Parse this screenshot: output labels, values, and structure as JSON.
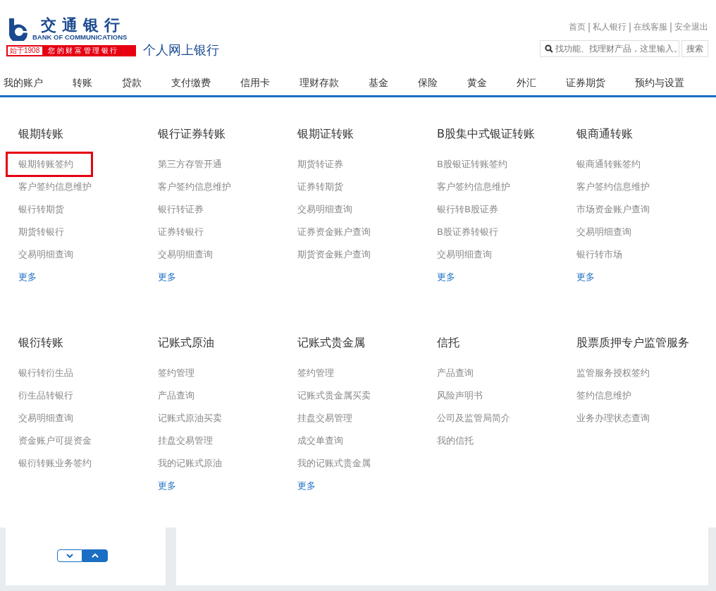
{
  "logo": {
    "name_cn": "交通银行",
    "name_en": "BANK OF COMMUNICATIONS",
    "since": "始于1908",
    "slogan": "您的财富管理银行"
  },
  "site_title": "个人网上银行",
  "top_links": [
    "首页",
    "私人银行",
    "在线客服",
    "安全退出"
  ],
  "search": {
    "placeholder": "找功能、找理财产品，这里输入。",
    "button": "搜索"
  },
  "nav": [
    "我的账户",
    "转账",
    "贷款",
    "支付缴费",
    "信用卡",
    "理财存款",
    "基金",
    "保险",
    "黄金",
    "外汇",
    "证券期货",
    "预约与设置"
  ],
  "menu_sections": [
    {
      "groups": [
        {
          "title": "银期转账",
          "items": [
            {
              "label": "银期转账签约",
              "selected": true
            },
            {
              "label": "客户签约信息维护",
              "selected": false
            },
            {
              "label": "银行转期货",
              "selected": false
            },
            {
              "label": "期货转银行",
              "selected": false
            },
            {
              "label": "交易明细查询",
              "selected": false
            }
          ],
          "more": "更多"
        },
        {
          "title": "银行证券转账",
          "items": [
            {
              "label": "第三方存管开通",
              "selected": false
            },
            {
              "label": "客户签约信息维护",
              "selected": false
            },
            {
              "label": "银行转证券",
              "selected": false
            },
            {
              "label": "证券转银行",
              "selected": false
            },
            {
              "label": "交易明细查询",
              "selected": false
            }
          ],
          "more": "更多"
        },
        {
          "title": "银期证转账",
          "items": [
            {
              "label": "期货转证券",
              "selected": false
            },
            {
              "label": "证券转期货",
              "selected": false
            },
            {
              "label": "交易明细查询",
              "selected": false
            },
            {
              "label": "证券资金账户查询",
              "selected": false
            },
            {
              "label": "期货资金账户查询",
              "selected": false
            }
          ]
        },
        {
          "title": "B股集中式银证转账",
          "items": [
            {
              "label": "B股银证转账签约",
              "selected": false
            },
            {
              "label": "客户签约信息维护",
              "selected": false
            },
            {
              "label": "银行转B股证券",
              "selected": false
            },
            {
              "label": "B股证券转银行",
              "selected": false
            },
            {
              "label": "交易明细查询",
              "selected": false
            }
          ],
          "more": "更多"
        },
        {
          "title": "银商通转账",
          "items": [
            {
              "label": "银商通转账签约",
              "selected": false
            },
            {
              "label": "客户签约信息维护",
              "selected": false
            },
            {
              "label": "市场资金账户查询",
              "selected": false
            },
            {
              "label": "交易明细查询",
              "selected": false
            },
            {
              "label": "银行转市场",
              "selected": false
            }
          ],
          "more": "更多"
        }
      ]
    },
    {
      "groups": [
        {
          "title": "银衍转账",
          "items": [
            {
              "label": "银行转衍生品",
              "selected": false
            },
            {
              "label": "衍生品转银行",
              "selected": false
            },
            {
              "label": "交易明细查询",
              "selected": false
            },
            {
              "label": "资金账户可提资金",
              "selected": false
            },
            {
              "label": "银衍转账业务签约",
              "selected": false
            }
          ]
        },
        {
          "title": "记账式原油",
          "items": [
            {
              "label": "签约管理",
              "selected": false
            },
            {
              "label": "产品查询",
              "selected": false
            },
            {
              "label": "记账式原油买卖",
              "selected": false
            },
            {
              "label": "挂盘交易管理",
              "selected": false
            },
            {
              "label": "我的记账式原油",
              "selected": false
            }
          ],
          "more": "更多"
        },
        {
          "title": "记账式贵金属",
          "items": [
            {
              "label": "签约管理",
              "selected": false
            },
            {
              "label": "记账式贵金属买卖",
              "selected": false
            },
            {
              "label": "挂盘交易管理",
              "selected": false
            },
            {
              "label": "成交单查询",
              "selected": false
            },
            {
              "label": "我的记账式贵金属",
              "selected": false
            }
          ],
          "more": "更多"
        },
        {
          "title": "信托",
          "items": [
            {
              "label": "产品查询",
              "selected": false
            },
            {
              "label": "风险声明书",
              "selected": false
            },
            {
              "label": "公司及监管局简介",
              "selected": false
            },
            {
              "label": "我的信托",
              "selected": false
            }
          ]
        },
        {
          "title": "股票质押专户监管服务",
          "items": [
            {
              "label": "监管服务授权签约",
              "selected": false
            },
            {
              "label": "签约信息维护",
              "selected": false
            },
            {
              "label": "业务办理状态查询",
              "selected": false
            }
          ]
        }
      ]
    }
  ],
  "collapse_toggle": [
    {
      "kind": "down",
      "selected": false
    },
    {
      "kind": "up",
      "selected": true
    }
  ]
}
